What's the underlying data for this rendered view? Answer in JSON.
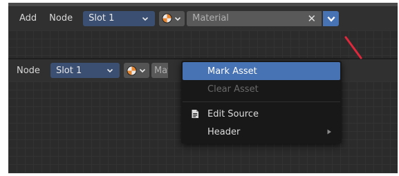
{
  "top_header": {
    "menu_add": "Add",
    "menu_node": "Node",
    "slot": "Slot 1",
    "material_name": "Material",
    "clear_glyph": "✕"
  },
  "bottom_header": {
    "menu_node": "Node",
    "slot": "Slot 1",
    "material_name": "Mate"
  },
  "context_menu": {
    "items": [
      {
        "label": "Mark Asset",
        "state": "highlighted"
      },
      {
        "label": "Clear Asset",
        "state": "disabled"
      },
      {
        "label": "Edit Source",
        "icon": "document-icon"
      },
      {
        "label": "Header",
        "submenu": true
      }
    ]
  },
  "colors": {
    "accent": "#4772b3",
    "slot_bg": "#3b4f72",
    "annotation_arrow": "#e0283c",
    "editor_bg": "#2b2b2b",
    "header_bg": "#303030"
  }
}
